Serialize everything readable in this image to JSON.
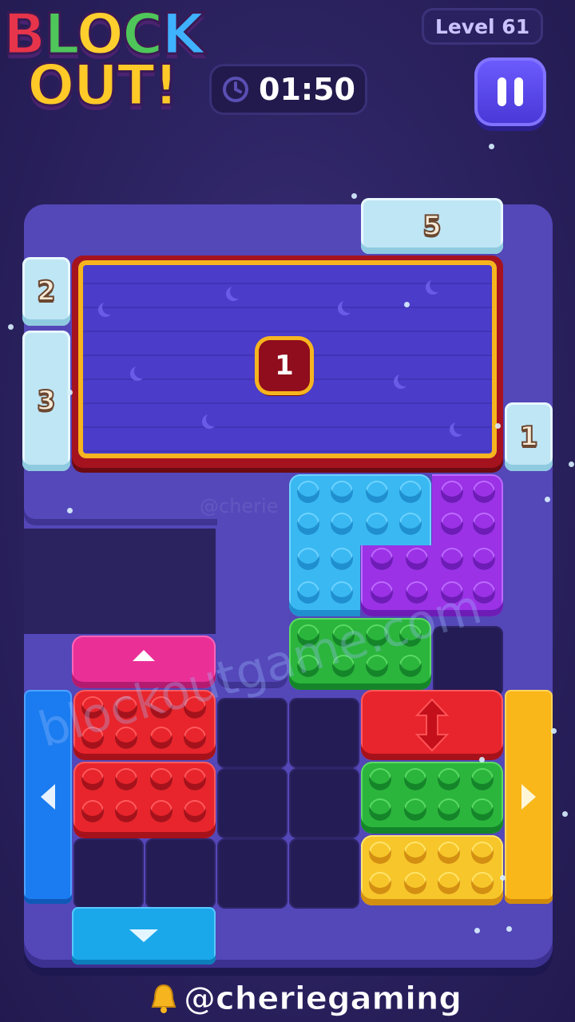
{
  "header": {
    "logo_line1": [
      "B",
      "L",
      "O",
      "C",
      "K"
    ],
    "logo_line2": "OUT!",
    "level_label": "Level 61",
    "timer": "01:50",
    "pause_icon": "pause-icon",
    "clock_icon": "clock-icon"
  },
  "board": {
    "goal_count": "1",
    "frozen_tiles": {
      "top": "5",
      "left_top": "2",
      "left_bottom": "3",
      "right": "1"
    }
  },
  "watermark": "blockoutgame.com",
  "watermark_small": "@cherie",
  "credit": "@cheriegaming",
  "colors": {
    "background": "#2b2260",
    "frame": "#5447b8",
    "blue": "#3ab8f2",
    "purple": "#9b32e6",
    "green": "#2bb53c",
    "red": "#e8252c",
    "yellow": "#f7c62a",
    "pink": "#ea2f97"
  }
}
